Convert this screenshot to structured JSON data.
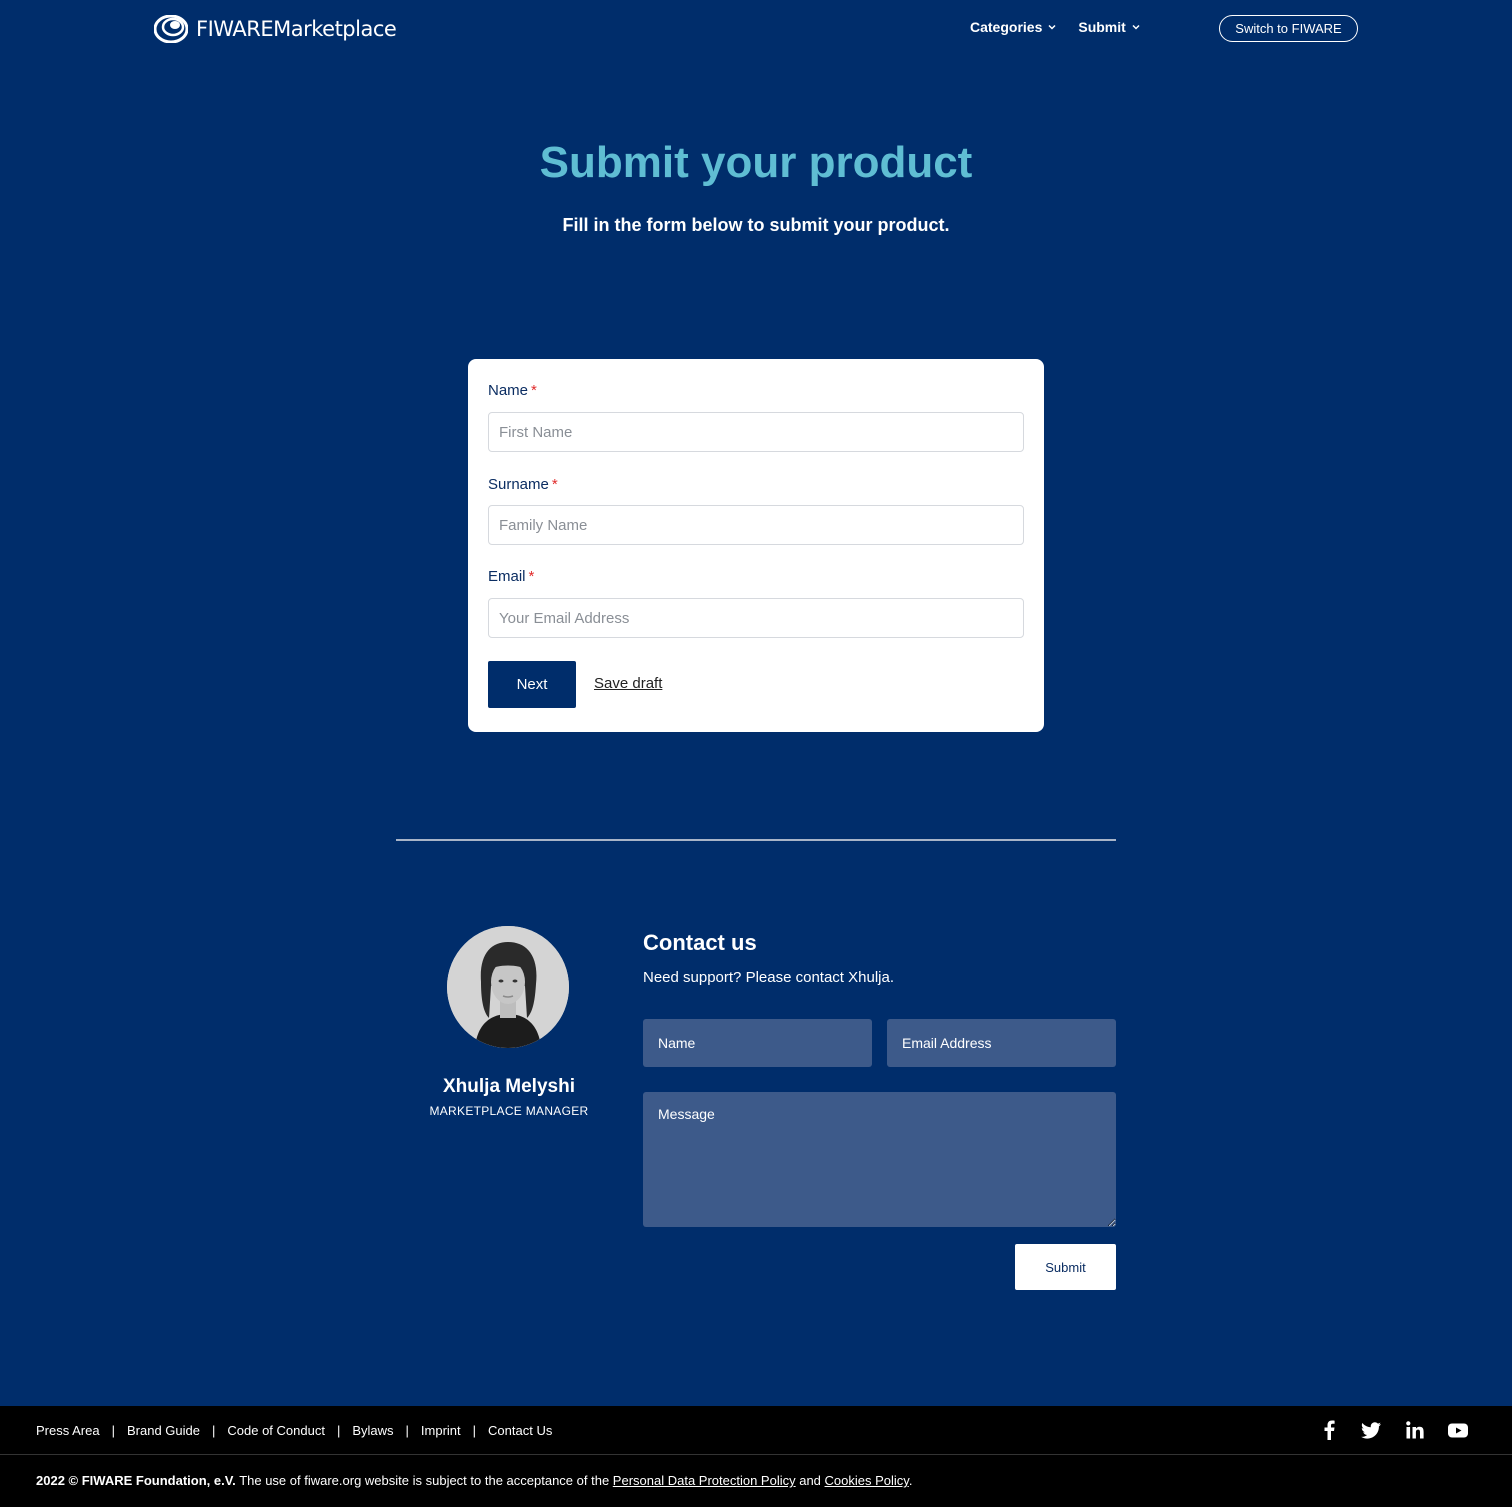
{
  "header": {
    "logo_text": "FIWAREMarketplace",
    "nav": [
      {
        "label": "Categories"
      },
      {
        "label": "Submit"
      }
    ],
    "switch_label": "Switch to FIWARE"
  },
  "hero": {
    "title": "Submit your product",
    "subtitle": "Fill in the form below to submit your product."
  },
  "form": {
    "name_label": "Name",
    "name_placeholder": "First Name",
    "surname_label": "Surname",
    "surname_placeholder": "Family Name",
    "email_label": "Email",
    "email_placeholder": "Your Email Address",
    "required_mark": "*",
    "next_label": "Next",
    "save_draft_label": "Save draft"
  },
  "contact": {
    "person_name": "Xhulja Melyshi",
    "person_role": "MARKETPLACE MANAGER",
    "title": "Contact us",
    "subtitle": "Need support? Please contact Xhulja.",
    "name_placeholder": "Name",
    "email_placeholder": "Email Address",
    "message_placeholder": "Message",
    "submit_label": "Submit"
  },
  "footer": {
    "links": [
      "Press Area",
      "Brand Guide",
      "Code of Conduct",
      "Bylaws",
      "Imprint",
      "Contact Us"
    ],
    "separator": "|",
    "social": [
      "facebook-icon",
      "twitter-icon",
      "linkedin-icon",
      "youtube-icon"
    ],
    "copyright_bold": "2022 © FIWARE Foundation, e.V.",
    "copyright_text": " The use of fiware.org website is subject to the acceptance of the ",
    "privacy_link": "Personal Data Protection Policy",
    "and_text": " and ",
    "cookies_link": "Cookies Policy",
    "period": "."
  },
  "colors": {
    "background": "#002d6b",
    "accent_title": "#5fbdd3",
    "input_dark": "#3d5a8a",
    "required": "#e02b2b"
  }
}
